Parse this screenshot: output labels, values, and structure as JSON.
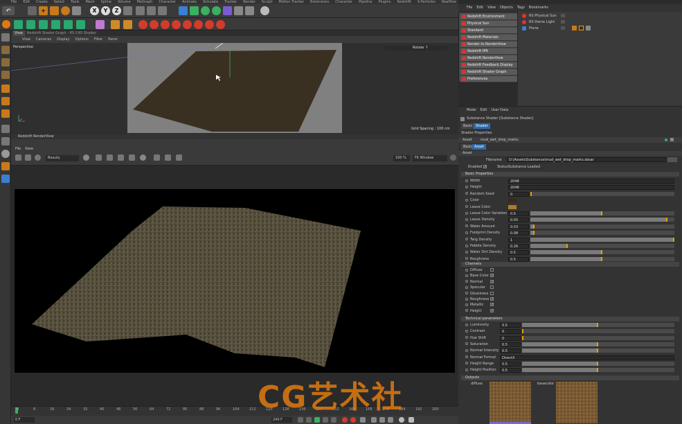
{
  "menubar": [
    "File",
    "Edit",
    "Create",
    "Select",
    "Tools",
    "Mesh",
    "Spline",
    "Volume",
    "MoGraph",
    "Character",
    "Animate",
    "Simulate",
    "Tracker",
    "Render",
    "Sculpt",
    "Motion Tracker",
    "Extensions",
    "Character",
    "Pipeline",
    "Plugins",
    "Redshift",
    "X-Particles",
    "Realflow",
    "Script",
    "Window",
    "Help"
  ],
  "axis_buttons": [
    "X",
    "Y",
    "Z"
  ],
  "viewport": {
    "tabs": [
      "View",
      "Redshift Shader Graph - RS C4D Shader"
    ],
    "menu": [
      "View",
      "Cameras",
      "Display",
      "Options",
      "Filter",
      "Panel"
    ],
    "label": "Perspective",
    "status": "Rotate ↑",
    "grid_spacing": "Grid Spacing : 100 cm"
  },
  "render_view": {
    "title": "Redshift RenderView",
    "menu": [
      "File",
      "View"
    ],
    "mode": "Beauty",
    "zoom": "100 %",
    "fit": "Fit Window"
  },
  "timeline": {
    "ticks": [
      "0",
      "8",
      "16",
      "24",
      "32",
      "40",
      "48",
      "56",
      "64",
      "72",
      "80",
      "88",
      "96",
      "104",
      "112",
      "120",
      "128",
      "136",
      "144",
      "152",
      "160",
      "168",
      "176",
      "184",
      "192",
      "200"
    ],
    "start": "0 F",
    "end": "240 F"
  },
  "right_menu": [
    "File",
    "Edit",
    "View",
    "Objects",
    "Tags",
    "Bookmarks"
  ],
  "dropdown_items": [
    "Redshift Environment",
    "Physical Sun",
    "Standard",
    "Redshift Materials",
    "Render to RenderView",
    "Redshift IPR",
    "Redshift RenderView",
    "Redshift Feedback Display",
    "Redshift Shader Graph Editor",
    "Preferences"
  ],
  "objects": [
    "RS Physical Sun",
    "RS Dome Light",
    "Plane"
  ],
  "attr": {
    "menu": [
      "Mode",
      "Edit",
      "User Data"
    ],
    "title": "Substance Shader [Substance Shader]",
    "tabs": [
      "Basic",
      "Shader"
    ],
    "shader_props": "Shader Properties",
    "asset_tabs": [
      "Asset",
      "mud_wet_drop_marks"
    ],
    "subtabs": [
      "Basic",
      "Asset"
    ],
    "asset_label": "Asset",
    "filename_label": "Filename",
    "filename": "D:\\Assets\\Substance\\mud_wet_drop_marks.sbsar",
    "enabled_label": "Enabled",
    "status_label": "Status",
    "status": "Substance Loaded",
    "basic_section": "Basic Properties",
    "basic": [
      {
        "label": "Width",
        "value": "2048",
        "kind": "select"
      },
      {
        "label": "Height",
        "value": "2048",
        "kind": "select"
      },
      {
        "label": "Random Seed",
        "value": "0",
        "kind": "num",
        "level": 0.0
      },
      {
        "label": "Color",
        "value": "",
        "kind": "color",
        "color": "#3a2a18"
      },
      {
        "label": "Leave Color",
        "value": "",
        "kind": "color",
        "color": "#b07a2a"
      },
      {
        "label": "Leave Color Variation",
        "value": "0.5",
        "kind": "num",
        "level": 0.5
      },
      {
        "label": "Leave Density",
        "value": "0.05",
        "kind": "num",
        "level": 0.95
      },
      {
        "label": "Water Amount",
        "value": "0.03",
        "kind": "num",
        "level": 0.03
      },
      {
        "label": "Footprint Density",
        "value": "0.08",
        "kind": "num",
        "level": 0.03
      },
      {
        "label": "Twig Density",
        "value": "1",
        "kind": "num",
        "level": 1.0
      },
      {
        "label": "Pebble Density",
        "value": "0.26",
        "kind": "num",
        "level": 0.26
      },
      {
        "label": "Water Dirt Density",
        "value": "0.5",
        "kind": "num",
        "level": 0.5
      },
      {
        "label": "Roughness",
        "value": "0.5",
        "kind": "num",
        "level": 0.5
      }
    ],
    "channels_section": "Channels",
    "channels": [
      {
        "label": "Diffuse",
        "checked": false
      },
      {
        "label": "Base Color",
        "checked": true
      },
      {
        "label": "Normal",
        "checked": true
      },
      {
        "label": "Specular",
        "checked": false
      },
      {
        "label": "Glossiness",
        "checked": false
      },
      {
        "label": "Roughness",
        "checked": true
      },
      {
        "label": "Metallic",
        "checked": true
      },
      {
        "label": "Height",
        "checked": true
      }
    ],
    "tech_section": "Technical parameters",
    "tech": [
      {
        "label": "Luminosity",
        "value": "0.5",
        "level": 0.5
      },
      {
        "label": "Contrast",
        "value": "0",
        "level": 0.0
      },
      {
        "label": "Hue Shift",
        "value": "0",
        "level": 0.0
      },
      {
        "label": "Saturation",
        "value": "0.5",
        "level": 0.5
      },
      {
        "label": "Normal Intensity",
        "value": "0.5",
        "level": 0.5
      },
      {
        "label": "Normal Format",
        "value": "DirectX",
        "level": -1
      },
      {
        "label": "Height Range",
        "value": "0.5",
        "level": 0.5
      },
      {
        "label": "Height Position",
        "value": "0.5",
        "level": 0.5
      }
    ],
    "outputs_section": "Outputs",
    "outputs": [
      "diffuse",
      "basecolor"
    ]
  },
  "watermark": "CG艺术社",
  "colors": {
    "accent": "#e8a000",
    "red_icon": "#d33b2b",
    "watermark": "#e07a10"
  }
}
